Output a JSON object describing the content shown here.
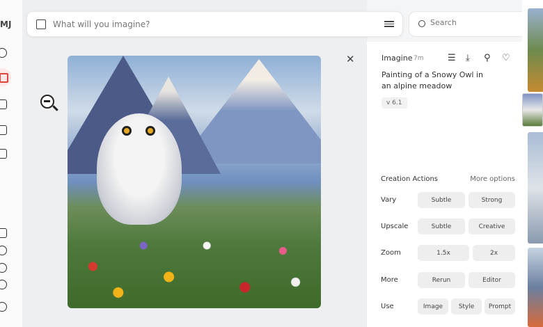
{
  "sidebar": {
    "logo": "MJ",
    "items": [
      "explore-icon",
      "create-icon",
      "organize-icon",
      "chat-icon",
      "tasks-icon"
    ],
    "bottom": [
      "lab-icon",
      "help-icon",
      "notifications-icon",
      "theme-icon",
      "profile-icon"
    ],
    "active_color": "#e2453c"
  },
  "prompt": {
    "placeholder": "What will you imagine?"
  },
  "search": {
    "placeholder": "Search"
  },
  "detail": {
    "type": "Imagine",
    "time": "7m",
    "title": "Painting of a Snowy Owl in an alpine meadow",
    "version": "v 6.1"
  },
  "actions": {
    "heading": "Creation Actions",
    "more": "More options",
    "rows": [
      {
        "label": "Vary",
        "buttons": [
          "Subtle",
          "Strong"
        ]
      },
      {
        "label": "Upscale",
        "buttons": [
          "Subtle",
          "Creative"
        ]
      },
      {
        "label": "Zoom",
        "buttons": [
          "1.5x",
          "2x"
        ]
      },
      {
        "label": "More",
        "buttons": [
          "Rerun",
          "Editor"
        ]
      },
      {
        "label": "Use",
        "buttons": [
          "Image",
          "Style",
          "Prompt"
        ]
      }
    ]
  }
}
